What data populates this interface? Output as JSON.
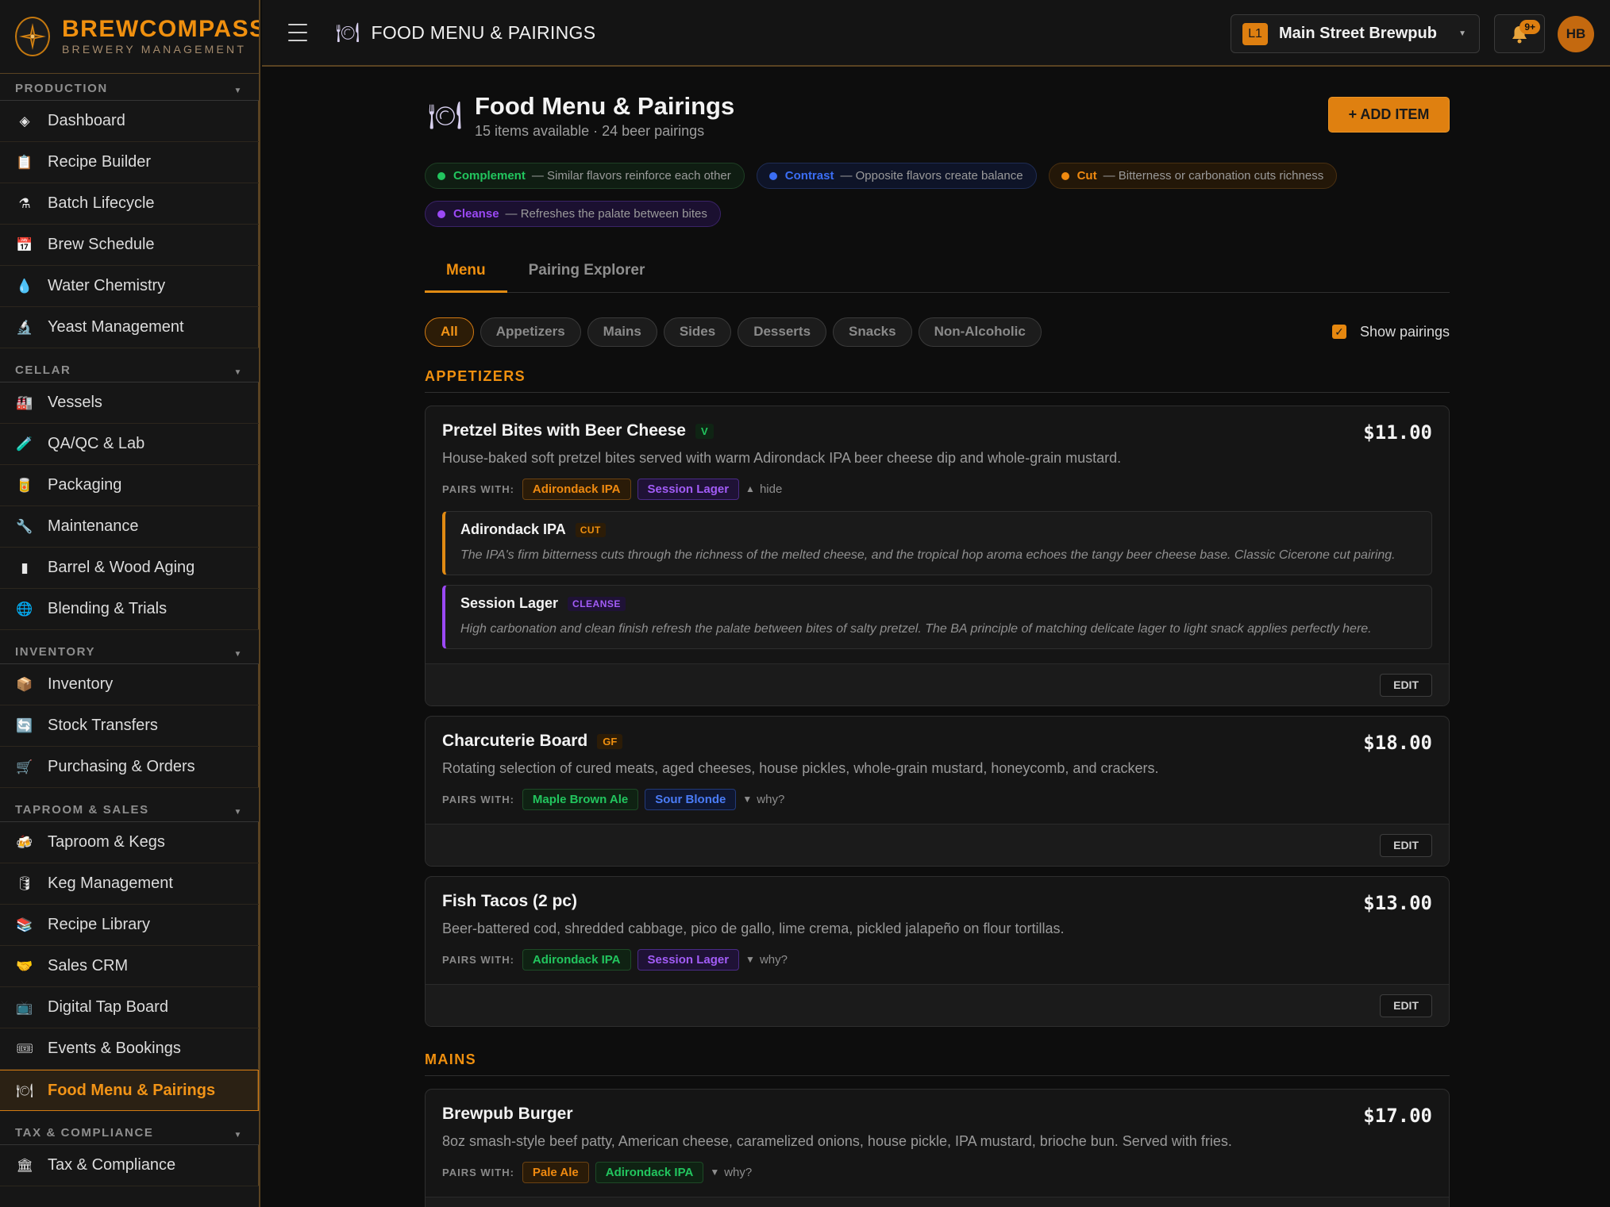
{
  "brand": {
    "name": "BREWCOMPASS",
    "sub": "BREWERY MANAGEMENT"
  },
  "sidebar": {
    "sections": [
      {
        "title": "PRODUCTION",
        "items": [
          {
            "label": "Dashboard",
            "icon": "dashboard-icon"
          },
          {
            "label": "Recipe Builder",
            "icon": "clipboard-icon"
          },
          {
            "label": "Batch Lifecycle",
            "icon": "flask-icon"
          },
          {
            "label": "Brew Schedule",
            "icon": "calendar-icon"
          },
          {
            "label": "Water Chemistry",
            "icon": "droplet-icon"
          },
          {
            "label": "Yeast Management",
            "icon": "microscope-icon"
          }
        ]
      },
      {
        "title": "CELLAR",
        "items": [
          {
            "label": "Vessels",
            "icon": "factory-icon"
          },
          {
            "label": "QA/QC & Lab",
            "icon": "test-tube-icon"
          },
          {
            "label": "Packaging",
            "icon": "can-icon"
          },
          {
            "label": "Maintenance",
            "icon": "wrench-icon"
          },
          {
            "label": "Barrel & Wood Aging",
            "icon": "barrel-icon"
          },
          {
            "label": "Blending & Trials",
            "icon": "globe-icon"
          }
        ]
      },
      {
        "title": "INVENTORY",
        "items": [
          {
            "label": "Inventory",
            "icon": "package-icon"
          },
          {
            "label": "Stock Transfers",
            "icon": "transfer-icon"
          },
          {
            "label": "Purchasing & Orders",
            "icon": "cart-icon"
          }
        ]
      },
      {
        "title": "TAPROOM & SALES",
        "items": [
          {
            "label": "Taproom & Kegs",
            "icon": "beer-icon"
          },
          {
            "label": "Keg Management",
            "icon": "keg-icon"
          },
          {
            "label": "Recipe Library",
            "icon": "books-icon"
          },
          {
            "label": "Sales CRM",
            "icon": "handshake-icon"
          },
          {
            "label": "Digital Tap Board",
            "icon": "tv-icon"
          },
          {
            "label": "Events & Bookings",
            "icon": "ticket-icon"
          },
          {
            "label": "Food Menu & Pairings",
            "icon": "plate-icon",
            "active": true
          }
        ]
      },
      {
        "title": "TAX & COMPLIANCE",
        "items": [
          {
            "label": "Tax & Compliance",
            "icon": "bank-icon"
          }
        ]
      }
    ]
  },
  "header": {
    "title": "FOOD MENU & PAIRINGS",
    "location_badge": "L1",
    "location_name": "Main Street Brewpub",
    "notif_count": "9+",
    "avatar": "HB"
  },
  "page": {
    "title": "Food Menu & Pairings",
    "subtitle": "15 items available · 24 beer pairings",
    "add_label": "+ ADD ITEM"
  },
  "legend": [
    {
      "key": "complement",
      "name": "Complement",
      "desc": "— Similar flavors reinforce each other",
      "color": "#22c55e"
    },
    {
      "key": "contrast",
      "name": "Contrast",
      "desc": "— Opposite flavors create balance",
      "color": "#3b6ef5"
    },
    {
      "key": "cut",
      "name": "Cut",
      "desc": "— Bitterness or carbonation cuts richness",
      "color": "#f08a10"
    },
    {
      "key": "cleanse",
      "name": "Cleanse",
      "desc": "— Refreshes the palate between bites",
      "color": "#9b49f5"
    }
  ],
  "tabs": [
    {
      "label": "Menu",
      "active": true
    },
    {
      "label": "Pairing Explorer",
      "active": false
    }
  ],
  "filters": [
    "All",
    "Appetizers",
    "Mains",
    "Sides",
    "Desserts",
    "Snacks",
    "Non-Alcoholic"
  ],
  "active_filter": "All",
  "show_pairings": {
    "label": "Show pairings",
    "checked": true
  },
  "common": {
    "pairs_with": "PAIRS WITH:",
    "hide": "hide",
    "why": "why?",
    "edit": "EDIT"
  },
  "categories": [
    {
      "title": "APPETIZERS",
      "items": [
        {
          "name": "Pretzel Bites with Beer Cheese",
          "diet": "V",
          "price": "$11.00",
          "desc": "House-baked soft pretzel bites served with warm Adirondack IPA beer cheese dip and whole-grain mustard.",
          "pairs": [
            {
              "beer": "Adirondack IPA",
              "type": "cut"
            },
            {
              "beer": "Session Lager",
              "type": "cleanse"
            }
          ],
          "expanded": true,
          "details": [
            {
              "beer": "Adirondack IPA",
              "type": "cut",
              "type_label": "CUT",
              "text": "The IPA's firm bitterness cuts through the richness of the melted cheese, and the tropical hop aroma echoes the tangy beer cheese base. Classic Cicerone cut pairing."
            },
            {
              "beer": "Session Lager",
              "type": "cleanse",
              "type_label": "CLEANSE",
              "text": "High carbonation and clean finish refresh the palate between bites of salty pretzel. The BA principle of matching delicate lager to light snack applies perfectly here."
            }
          ]
        },
        {
          "name": "Charcuterie Board",
          "diet": "GF",
          "price": "$18.00",
          "desc": "Rotating selection of cured meats, aged cheeses, house pickles, whole-grain mustard, honeycomb, and crackers.",
          "pairs": [
            {
              "beer": "Maple Brown Ale",
              "type": "complement"
            },
            {
              "beer": "Sour Blonde",
              "type": "contrast"
            }
          ],
          "expanded": false
        },
        {
          "name": "Fish Tacos (2 pc)",
          "diet": "",
          "price": "$13.00",
          "desc": "Beer-battered cod, shredded cabbage, pico de gallo, lime crema, pickled jalapeño on flour tortillas.",
          "pairs": [
            {
              "beer": "Adirondack IPA",
              "type": "complement"
            },
            {
              "beer": "Session Lager",
              "type": "cleanse"
            }
          ],
          "expanded": false
        }
      ]
    },
    {
      "title": "MAINS",
      "items": [
        {
          "name": "Brewpub Burger",
          "diet": "",
          "price": "$17.00",
          "desc": "8oz smash-style beef patty, American cheese, caramelized onions, house pickle, IPA mustard, brioche bun. Served with fries.",
          "pairs": [
            {
              "beer": "Pale Ale",
              "type": "cut"
            },
            {
              "beer": "Adirondack IPA",
              "type": "complement"
            }
          ],
          "expanded": false
        }
      ]
    }
  ]
}
